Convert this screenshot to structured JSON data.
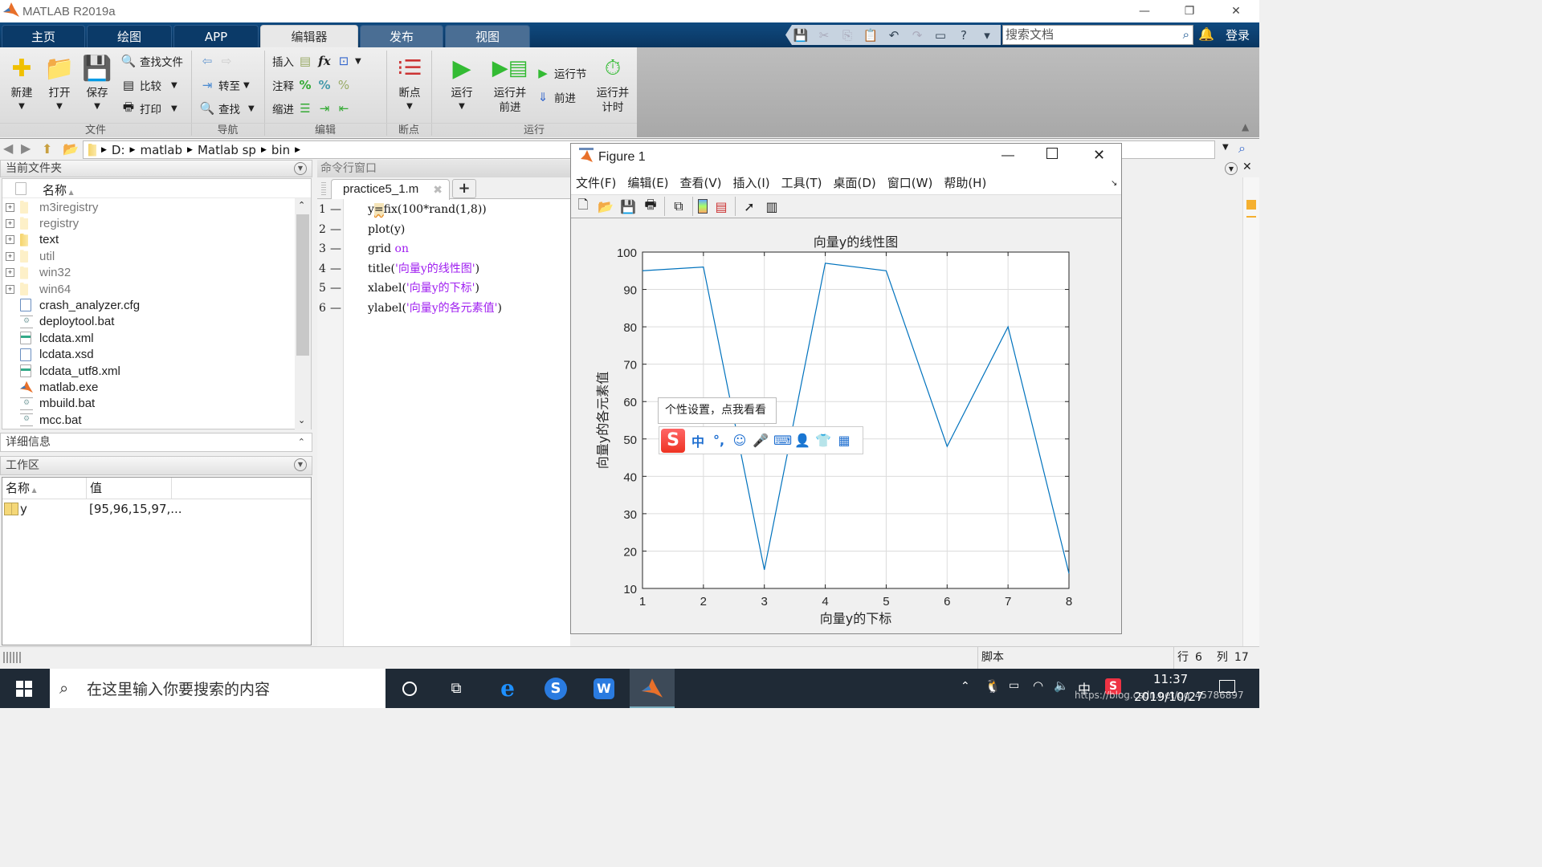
{
  "window": {
    "title": "MATLAB R2019a",
    "minimize": "—",
    "restore": "❐",
    "close": "✕"
  },
  "tabs": [
    {
      "label": "主页"
    },
    {
      "label": "绘图"
    },
    {
      "label": "APP"
    },
    {
      "label": "编辑器",
      "active": true
    },
    {
      "label": "发布"
    },
    {
      "label": "视图"
    }
  ],
  "quick_access": {
    "search_placeholder": "搜索文档",
    "login": "登录"
  },
  "ribbon": {
    "file": {
      "new": "新建",
      "open": "打开",
      "save": "保存",
      "find_files": "查找文件",
      "compare": "比较",
      "print": "打印",
      "section": "文件"
    },
    "navigate": {
      "goto": "转至",
      "find": "查找",
      "section": "导航"
    },
    "edit": {
      "insert": "插入",
      "comment": "注释",
      "indent": "缩进",
      "section": "编辑"
    },
    "breakpoints": {
      "label": "断点",
      "section": "断点"
    },
    "run": {
      "run": "运行",
      "run_advance_1": "运行并",
      "run_advance_2": "前进",
      "run_section": "运行节",
      "advance": "前进",
      "run_time_1": "运行并",
      "run_time_2": "计时",
      "section": "运行"
    }
  },
  "address": {
    "crumbs": [
      "D:",
      "matlab",
      "Matlab sp",
      "bin"
    ]
  },
  "current_folder": {
    "title": "当前文件夹",
    "column_name": "名称",
    "items": [
      {
        "name": "m3iregistry",
        "type": "folder",
        "gray": true
      },
      {
        "name": "registry",
        "type": "folder",
        "gray": true
      },
      {
        "name": "text",
        "type": "folder",
        "gray": false
      },
      {
        "name": "util",
        "type": "folder",
        "gray": true
      },
      {
        "name": "win32",
        "type": "folder",
        "gray": true
      },
      {
        "name": "win64",
        "type": "folder",
        "gray": true
      },
      {
        "name": "crash_analyzer.cfg",
        "type": "doc"
      },
      {
        "name": "deploytool.bat",
        "type": "bat"
      },
      {
        "name": "lcdata.xml",
        "type": "xml"
      },
      {
        "name": "lcdata.xsd",
        "type": "doc"
      },
      {
        "name": "lcdata_utf8.xml",
        "type": "xml"
      },
      {
        "name": "matlab.exe",
        "type": "exe"
      },
      {
        "name": "mbuild.bat",
        "type": "bat"
      },
      {
        "name": "mcc.bat",
        "type": "bat"
      }
    ]
  },
  "details": {
    "title": "详细信息"
  },
  "workspace": {
    "title": "工作区",
    "col_name": "名称",
    "col_value": "值",
    "rows": [
      {
        "name": "y",
        "value": "[95,96,15,97,..."
      }
    ]
  },
  "editor": {
    "command_window_title": "命令行窗口",
    "file_tab": "practice5_1.m",
    "lines": [
      {
        "num": "1",
        "parts": [
          [
            "plain",
            "y"
          ],
          [
            "plain",
            "=fix(100*rand(1,8))"
          ]
        ]
      },
      {
        "num": "2",
        "parts": [
          [
            "plain",
            "plot(y)"
          ]
        ]
      },
      {
        "num": "3",
        "parts": [
          [
            "plain",
            "grid "
          ],
          [
            "kw",
            "on"
          ]
        ]
      },
      {
        "num": "4",
        "parts": [
          [
            "plain",
            "title("
          ],
          [
            "str",
            "'向量y的线性图'"
          ],
          [
            "plain",
            ")"
          ]
        ]
      },
      {
        "num": "5",
        "parts": [
          [
            "plain",
            "xlabel("
          ],
          [
            "str",
            "'向量y的下标'"
          ],
          [
            "plain",
            ")"
          ]
        ]
      },
      {
        "num": "6",
        "parts": [
          [
            "plain",
            "ylabel("
          ],
          [
            "str",
            "'向量y的各元素值'"
          ],
          [
            "plain",
            ")"
          ]
        ]
      }
    ]
  },
  "figure": {
    "title": "Figure 1",
    "menu": [
      "文件(F)",
      "编辑(E)",
      "查看(V)",
      "插入(I)",
      "工具(T)",
      "桌面(D)",
      "窗口(W)",
      "帮助(H)"
    ]
  },
  "chart_data": {
    "type": "line",
    "title": "向量y的线性图",
    "xlabel": "向量y的下标",
    "ylabel": "向量y的各元素值",
    "x": [
      1,
      2,
      3,
      4,
      5,
      6,
      7,
      8
    ],
    "series": [
      {
        "name": "y",
        "values": [
          95,
          96,
          15,
          97,
          95,
          48,
          80,
          14
        ],
        "color": "#0072bd"
      }
    ],
    "xlim": [
      1,
      8
    ],
    "ylim": [
      10,
      100
    ],
    "xticks": [
      1,
      2,
      3,
      4,
      5,
      6,
      7,
      8
    ],
    "yticks": [
      10,
      20,
      30,
      40,
      50,
      60,
      70,
      80,
      90,
      100
    ],
    "grid": true
  },
  "ime": {
    "tooltip": "个性设置，点我看看",
    "logo": "S",
    "items": [
      "中",
      "°,",
      "☺",
      "🎤",
      "⌨",
      "👤",
      "👕",
      "▦"
    ]
  },
  "status": {
    "type": "脚本",
    "row_label": "行",
    "row": "6",
    "col_label": "列",
    "col": "17"
  },
  "taskbar": {
    "search_placeholder": "在这里输入你要搜索的内容",
    "time": "11:37",
    "date": "2019/10/27",
    "ime_lang": "中",
    "watermark": "https://blog.csdn.net/qq_45786897"
  }
}
